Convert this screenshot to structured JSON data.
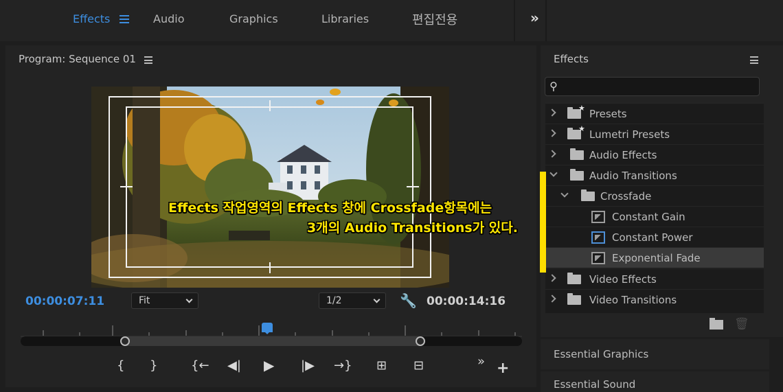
{
  "workspace_tabs": [
    "Effects",
    "Audio",
    "Graphics",
    "Libraries",
    "편집전용"
  ],
  "program": {
    "title": "Program: Sequence 01",
    "timecode_current": "00:00:07:11",
    "timecode_duration": "00:00:14:16",
    "zoom_select": "Fit",
    "resolution_select": "1/2"
  },
  "effects_panel": {
    "title": "Effects",
    "search_value": "",
    "tree": [
      {
        "label": "Presets",
        "type": "preset-folder",
        "expanded": false
      },
      {
        "label": "Lumetri Presets",
        "type": "preset-folder",
        "expanded": false
      },
      {
        "label": "Audio Effects",
        "type": "folder",
        "expanded": false
      },
      {
        "label": "Audio Transitions",
        "type": "folder",
        "expanded": true
      },
      {
        "label": "Crossfade",
        "type": "folder",
        "expanded": true
      },
      {
        "label": "Constant Gain",
        "type": "transition"
      },
      {
        "label": "Constant Power",
        "type": "transition"
      },
      {
        "label": "Exponential Fade",
        "type": "transition",
        "selected": true
      },
      {
        "label": "Video Effects",
        "type": "folder",
        "expanded": false
      },
      {
        "label": "Video Transitions",
        "type": "folder",
        "expanded": false
      }
    ]
  },
  "collapsed_panels": [
    "Essential Graphics",
    "Essential Sound"
  ],
  "annotation": {
    "line1": "Effects 작업영역의 Effects 창에 Crossfade항목에는",
    "line2": "3개의 Audio Transitions가 있다.",
    "color": "#ffe600"
  },
  "colors": {
    "accent": "#3d8ee0",
    "highlight_bar": "#ffde00"
  }
}
